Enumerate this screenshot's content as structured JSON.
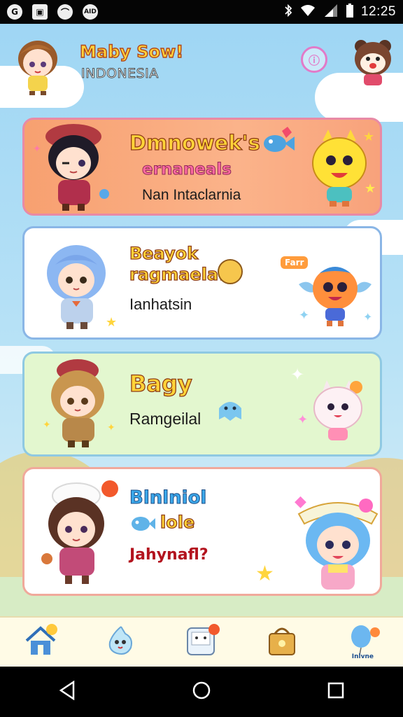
{
  "status_bar": {
    "left_icons": [
      "G",
      "▣",
      "⌒",
      "AID"
    ],
    "time": "12:25"
  },
  "header": {
    "title": "Maby Sow!",
    "subtitle": "INDONESIA"
  },
  "cards": [
    {
      "title": "Dmnowek's",
      "title2": "ernaneals",
      "subtitle": "Nan Intaclarnia",
      "accent": "#f9a679"
    },
    {
      "title": "Beayok",
      "title2": "ragmaela!",
      "subtitle": "Ianhatsin",
      "badge": "Farr",
      "accent": "#ffffff"
    },
    {
      "title": "Bagy",
      "subtitle": "Ramgeilal",
      "accent": "#e3f7cf"
    },
    {
      "title": "Blnlniol",
      "title2": "lole",
      "subtitle": "Jahynafl?",
      "accent": "#ffffff"
    }
  ],
  "bottom_nav": {
    "items": [
      {
        "icon": "home-icon"
      },
      {
        "icon": "bubble-friend-icon"
      },
      {
        "icon": "game-box-icon"
      },
      {
        "icon": "treasure-bag-icon"
      },
      {
        "icon": "balloon-icon",
        "label": "Inlvne"
      }
    ]
  },
  "system_nav": {
    "back": "back-icon",
    "home": "home-circle-icon",
    "recents": "recents-icon"
  }
}
